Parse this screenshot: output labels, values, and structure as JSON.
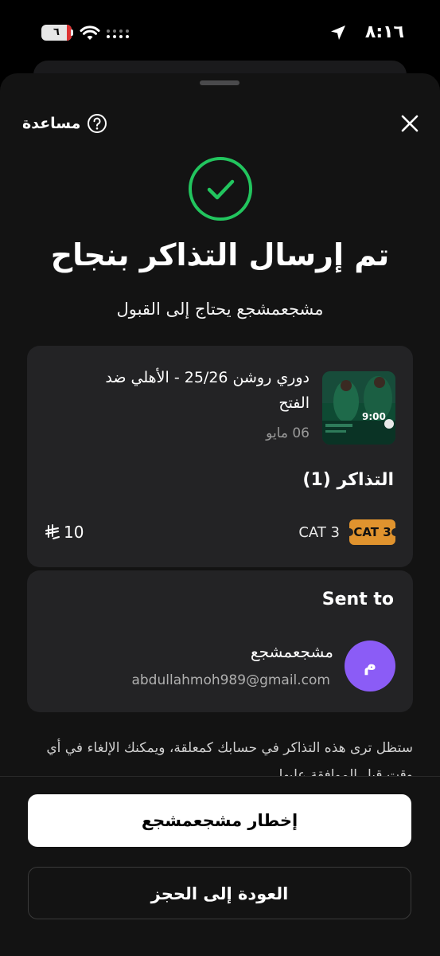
{
  "status_bar": {
    "time": "٨:١٦",
    "battery_level": "٦"
  },
  "header": {
    "help_label": "مساعدة"
  },
  "success": {
    "title": "تم إرسال التذاكر بنجاح",
    "subtitle": "مشجعمشجع يحتاج إلى القبول"
  },
  "event": {
    "title": "دوري روشن 25/26 - الأهلي ضد الفتح",
    "date": "06 مايو",
    "thumbnail_time": "9:00"
  },
  "tickets": {
    "title": "التذاكر (1)",
    "category_badge": "CAT 3",
    "category_label": "CAT 3",
    "price": "10",
    "currency_icon": "riyal-icon"
  },
  "recipient": {
    "section_title": "Sent to",
    "avatar_initial": "م",
    "name": "مشجعمشجع",
    "email": "abdullahmoh989@gmail.com"
  },
  "note": "ستظل ترى هذه التذاكر في حسابك كمعلقة، ويمكنك الإلغاء في أي وقت قبل الموافقة عليها.",
  "actions": {
    "notify_label": "إخطار مشجعمشجع",
    "back_label": "العودة إلى الحجز"
  },
  "colors": {
    "success_green": "#22c55e",
    "badge_orange": "#e0932e",
    "avatar_purple": "#8b5cf6"
  }
}
